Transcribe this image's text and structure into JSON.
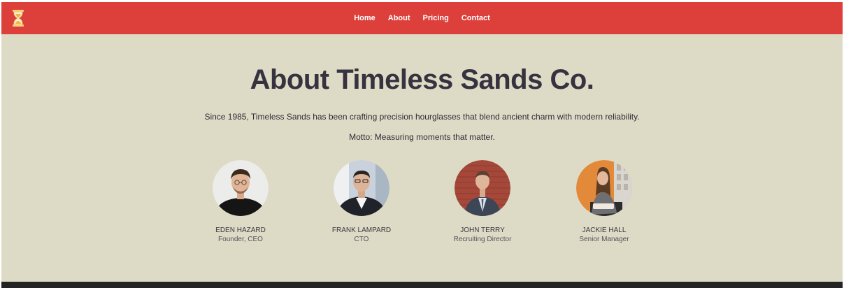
{
  "nav": {
    "logo_icon": "hourglass-icon",
    "links": [
      "Home",
      "About",
      "Pricing",
      "Contact"
    ]
  },
  "hero": {
    "title": "About Timeless Sands Co.",
    "description": "Since 1985, Timeless Sands has been crafting precision hourglasses that blend ancient charm with modern reliability.",
    "motto": "Motto: Measuring moments that matter."
  },
  "team": [
    {
      "name": "EDEN HAZARD",
      "role": "Founder, CEO"
    },
    {
      "name": "FRANK LAMPARD",
      "role": "CTO"
    },
    {
      "name": "JOHN TERRY",
      "role": "Recruiting Director"
    },
    {
      "name": "JACKIE HALL",
      "role": "Senior Manager"
    }
  ],
  "colors": {
    "navbar": "#dd3f3a",
    "hero_background": "#dddbc5",
    "title_text": "#36323f",
    "footer": "#232323"
  }
}
